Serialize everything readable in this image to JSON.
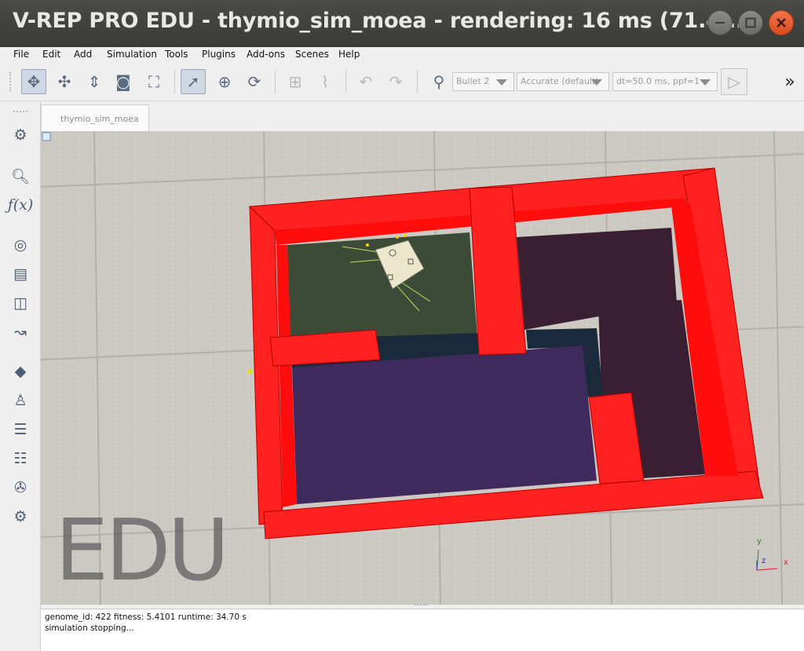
{
  "window": {
    "title": "V-REP PRO EDU - thymio_sim_moea - rendering: 16 ms (71.4 ..."
  },
  "menu": [
    "File",
    "Edit",
    "Add",
    "Simulation",
    "Tools",
    "Plugins",
    "Add-ons",
    "Scenes",
    "Help"
  ],
  "toolbar": {
    "engine": "Bullet 2",
    "accuracy": "Accurate (default)",
    "timestep": "dt=50.0 ms, ppf=1",
    "more": "»"
  },
  "tabs": [
    "thymio_sim_moea"
  ],
  "viewport": {
    "watermark": "EDU",
    "axes": {
      "x": "x",
      "y": "y",
      "z": "z"
    }
  },
  "console": {
    "lines": [
      "genome_id: 422 fitness: 5.4101 runtime: 34.70 s",
      "simulation stopping..."
    ]
  },
  "colors": {
    "wall": "#ff1f1f",
    "floor_green": "#3c4a38",
    "floor_purple": "#3f2a5e",
    "floor_dark": "#3a1e32"
  }
}
